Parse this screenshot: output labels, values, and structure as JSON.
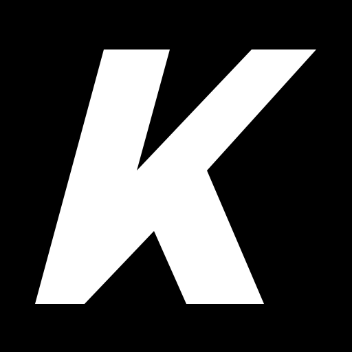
{
  "logo": {
    "letter": "K",
    "background_color": "#000000",
    "letter_color": "#ffffff"
  }
}
